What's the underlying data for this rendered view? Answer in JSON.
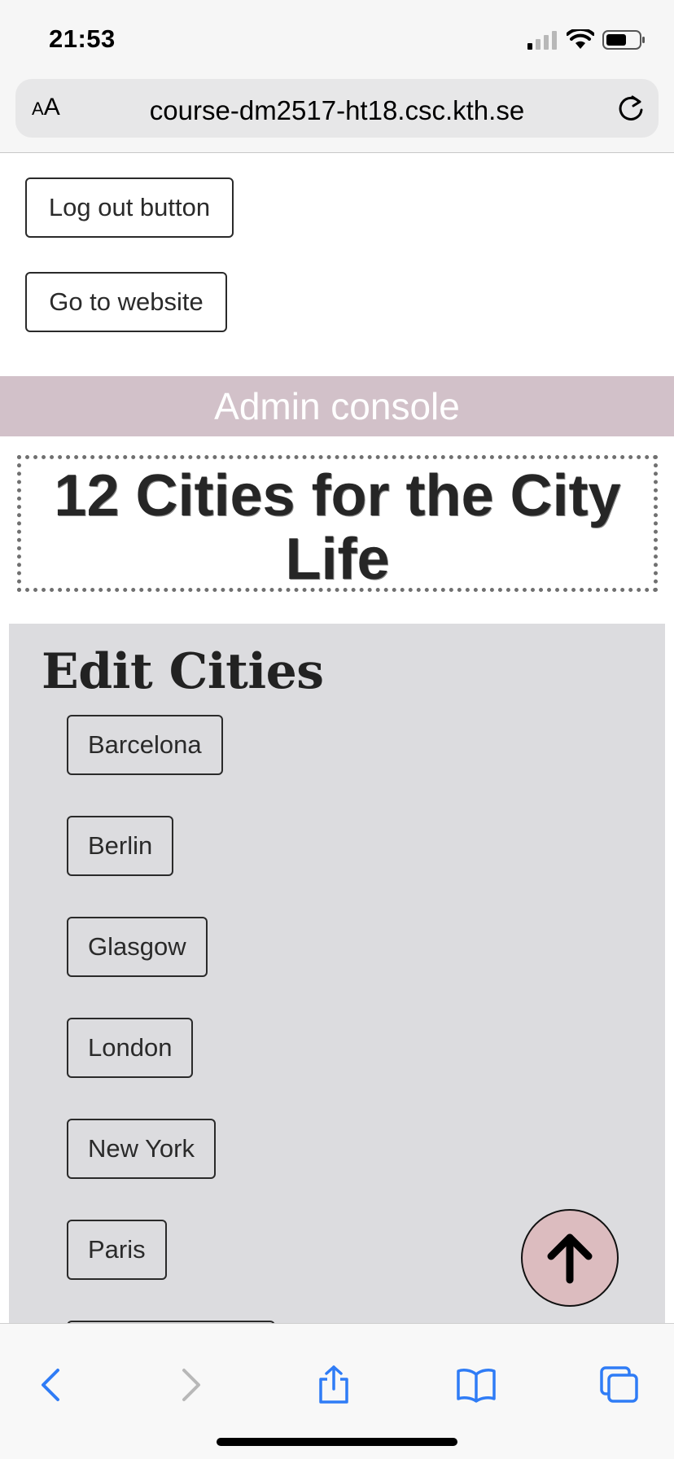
{
  "status_bar": {
    "time": "21:53"
  },
  "browser": {
    "text_size_button": "AA",
    "url": "course-dm2517-ht18.csc.kth.se"
  },
  "page": {
    "logout_label": "Log out button",
    "website_label": "Go to website",
    "admin_bar_title": "Admin console",
    "hero_title": "12 Cities for the City Life",
    "edit_heading": "Edit Cities",
    "cities": [
      "Barcelona",
      "Berlin",
      "Glasgow",
      "London",
      "New York",
      "Paris"
    ]
  },
  "icons": {
    "scroll_top": "arrow-up-icon",
    "toolbar": [
      "back-icon",
      "forward-icon",
      "share-icon",
      "bookmarks-icon",
      "tabs-icon"
    ]
  },
  "colors": {
    "admin_bar": "#d2c1c9",
    "edit_panel": "#dcdcdf",
    "scroll_top_button": "#dcbcbf",
    "safari_accent": "#2f7cf6"
  }
}
